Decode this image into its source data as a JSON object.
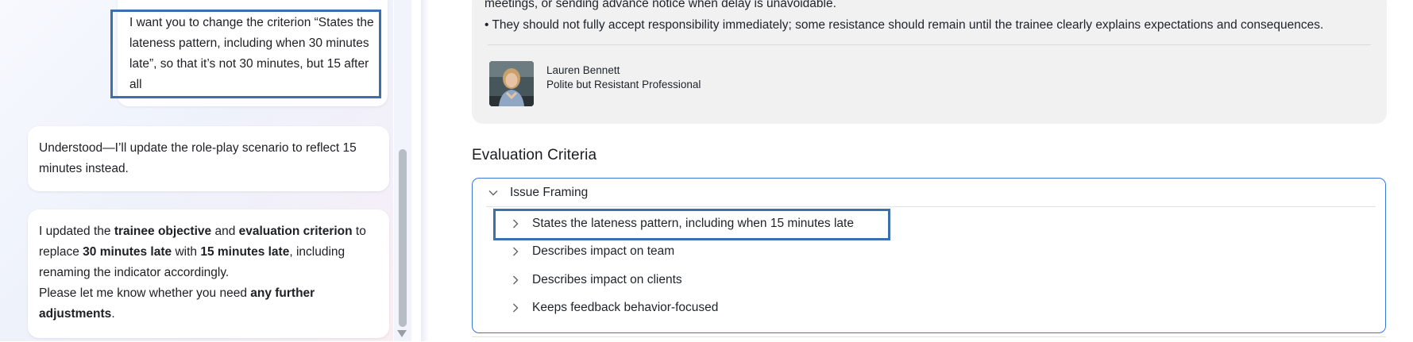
{
  "chat": {
    "user_message": "I want you to change the criterion “States the lateness pattern, including when 30 minutes late”, so that it’s not 30 minutes, but 15 after all",
    "assistant_reply_1": "Understood—I’ll update the role-play scenario to reflect 15 minutes instead.",
    "assistant_reply_2": {
      "t1": "I updated the ",
      "b1": "trainee objective",
      "t2": " and ",
      "b2": "evaluation criterion",
      "t3": " to replace ",
      "b3": "30 minutes late",
      "t4": " with ",
      "b4": "15 minutes late",
      "t5": ", including renaming the indicator accordingly.",
      "t6": "Please let me know whether you need ",
      "b5": "any further adjustments",
      "t7": "."
    }
  },
  "persona": {
    "text_line_1": "meetings, or sending advance notice when delay is unavoidable.",
    "text_line_2": "• They should not fully accept responsibility immediately; some resistance should remain until the trainee clearly explains expectations and consequences.",
    "name": "Lauren Bennett",
    "role": "Polite but Resistant Professional"
  },
  "evaluation": {
    "title": "Evaluation Criteria",
    "group": "Issue Framing",
    "criteria": [
      "States the lateness pattern, including when 15 minutes late",
      "Describes impact on team",
      "Describes impact on clients",
      "Keeps feedback behavior-focused"
    ]
  },
  "icons": {
    "group_toggle": "chevron-down-icon",
    "criterion_toggle": "chevron-right-icon",
    "scroll_down": "scroll-down-arrow-icon"
  },
  "colors": {
    "accent_border": "#3a78d8",
    "annotation_box": "#3b6fb0"
  }
}
